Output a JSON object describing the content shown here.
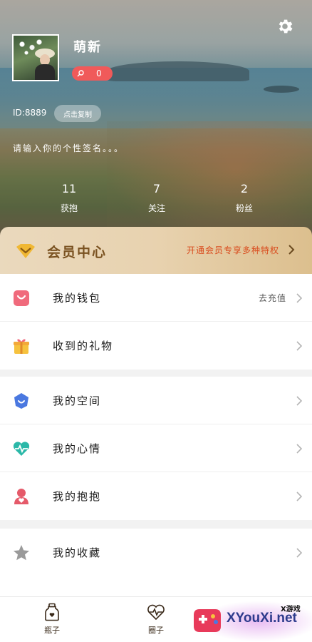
{
  "profile": {
    "nickname": "萌新",
    "points": "0",
    "id_text": "ID:8889",
    "copy_label": "点击复制",
    "signature_placeholder": "请输入你的个性签名。。。",
    "stats": [
      {
        "value": "11",
        "label": "获抱"
      },
      {
        "value": "7",
        "label": "关注"
      },
      {
        "value": "2",
        "label": "粉丝"
      }
    ]
  },
  "member": {
    "title": "会员中心",
    "promo": "开通会员专享多种特权"
  },
  "menu_sections": [
    {
      "items": [
        {
          "label": "我的钱包",
          "extra": "去充值",
          "icon": "wallet-icon"
        },
        {
          "label": "收到的礼物",
          "extra": "",
          "icon": "gift-icon"
        }
      ]
    },
    {
      "items": [
        {
          "label": "我的空间",
          "extra": "",
          "icon": "space-icon"
        },
        {
          "label": "我的心情",
          "extra": "",
          "icon": "mood-heart-icon"
        },
        {
          "label": "我的抱抱",
          "extra": "",
          "icon": "hug-icon"
        }
      ]
    },
    {
      "items": [
        {
          "label": "我的收藏",
          "extra": "",
          "icon": "star-icon"
        }
      ]
    }
  ],
  "bottom_nav": [
    {
      "label": "瓶子",
      "icon": "bottle-icon"
    },
    {
      "label": "圈子",
      "icon": "circle-heart-icon"
    }
  ],
  "watermark": {
    "brand": "XYouXi.net",
    "tag": "X游戏"
  },
  "colors": {
    "accent_red": "#f05a5a",
    "member_gold": "#e8d2af",
    "member_text": "#7a5221",
    "promo_orange": "#d94a1c",
    "wallet_pink": "#f06a7c",
    "gift_yellow": "#f6c23e",
    "space_blue": "#4a78e0",
    "mood_teal": "#2bb8a8",
    "hug_red": "#e55a6a",
    "star_gray": "#9a9a9a"
  }
}
